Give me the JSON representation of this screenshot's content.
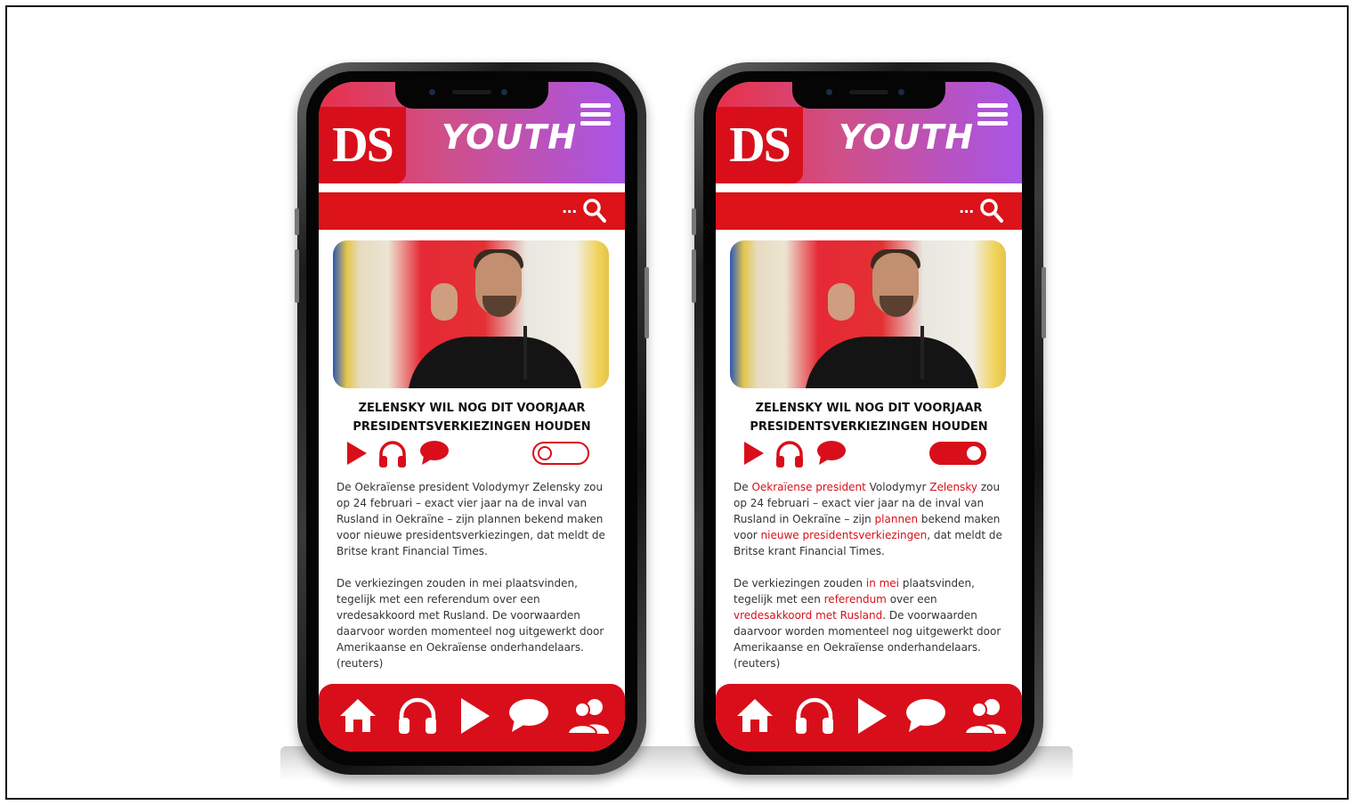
{
  "phones": [
    {
      "variant": "plain",
      "logo": "DS",
      "brand": "YOUTH",
      "search_hint": "...",
      "headline_line1": "ZELENSKY WIL NOG DIT VOORJAAR",
      "headline_line2": "PRESIDENTSVERKIEZINGEN HOUDEN",
      "toggle_state": "off",
      "paragraph1": "De Oekraïense president Volodymyr Zelensky zou op 24 februari – exact vier jaar na de inval van Rusland in Oekraïne – zijn plannen bekend maken voor nieuwe presidentsverkiezingen, dat meldt de Britse krant Financial Times.",
      "paragraph2": "De verkiezingen zouden in mei plaatsvinden, tegelijk met een referendum over een vredesakkoord met Rusland. De voorwaarden daarvoor worden momenteel nog uitgewerkt door Amerikaanse en Oekraïense onderhandelaars. (reuters)"
    },
    {
      "variant": "highlighted",
      "logo": "DS",
      "brand": "YOUTH",
      "search_hint": "...",
      "headline_line1": "ZELENSKY WIL NOG DIT VOORJAAR",
      "headline_line2": "PRESIDENTSVERKIEZINGEN HOUDEN",
      "toggle_state": "on",
      "p1": {
        "t1": "De ",
        "h1": "Oekraïense president",
        "t2": " Volodymyr ",
        "h2": "Zelensky",
        "t3": " zou op 24 februari – exact vier jaar na de inval van Rusland in Oekraïne – zijn ",
        "h3": "plannen",
        "t4": " bekend maken voor ",
        "h4": "nieuwe presidentsverkiezingen",
        "t5": ", dat meldt de Britse krant Financial Times."
      },
      "p2": {
        "t1": "De verkiezingen zouden ",
        "h1": "in mei",
        "t2": " plaatsvinden, tegelijk met een ",
        "h2": "referendum",
        "t3": " over een ",
        "h3": "vredesakkoord met Rusland",
        "t4": ". De voorwaarden daarvoor worden momenteel nog uitgewerkt door Amerikaanse en Oekraïense onderhandelaars. (reuters)"
      }
    }
  ],
  "icons": {
    "menu": "hamburger-menu-icon",
    "search": "search-icon",
    "play": "play-icon",
    "listen": "headphones-icon",
    "comment": "speech-bubble-icon",
    "nav": [
      "home-icon",
      "headphones-icon",
      "play-icon",
      "speech-bubble-icon",
      "users-icon"
    ]
  },
  "colors": {
    "brand_red": "#d80f1a",
    "header_gradient_start": "#e8304a",
    "header_gradient_end": "#a855e8"
  }
}
